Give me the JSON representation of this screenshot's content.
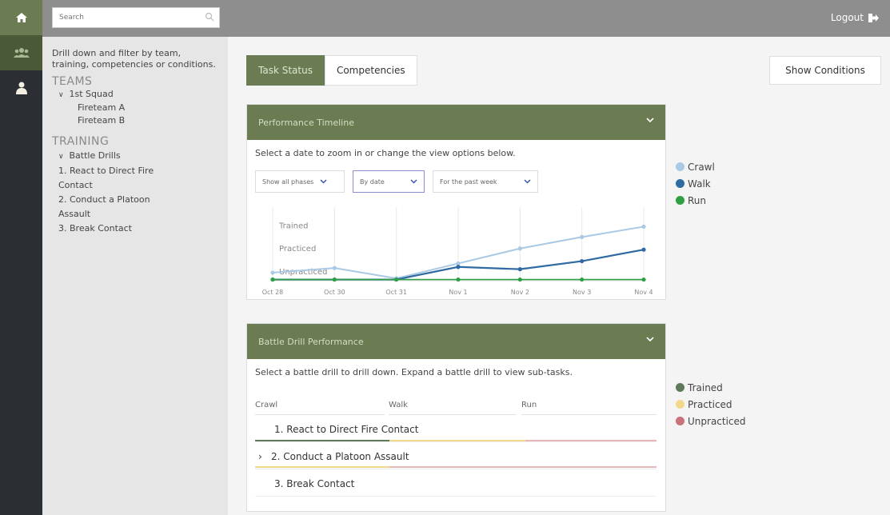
{
  "topbar": {
    "search_placeholder": "Search",
    "logout_label": "Logout"
  },
  "rail": {
    "icons": [
      "home-icon",
      "team-icon",
      "user-icon"
    ]
  },
  "filter": {
    "description": "Drill down and filter by team, training, competencies or conditions.",
    "teams_heading": "TEAMS",
    "squad": "1st Squad",
    "fireteam_a": "Fireteam A",
    "fireteam_b": "Fireteam B",
    "training_heading": "TRAINING",
    "battle_drills": "Battle Drills",
    "drill_1_line1": "1. React to Direct Fire",
    "drill_1_line2": "Contact",
    "drill_2_line1": "2. Conduct a Platoon",
    "drill_2_line2": "Assault",
    "drill_3": "3. Break Contact"
  },
  "tabs": {
    "task_status": "Task Status",
    "competencies": "Competencies",
    "show_conditions": "Show Conditions"
  },
  "performance": {
    "title": "Performance Timeline",
    "subtitle": "Select a date to zoom in or change the view options below.",
    "phase_select": "Show all phases",
    "by_select": "By date",
    "range_select": "For the past week"
  },
  "chart_data": {
    "type": "line",
    "x": [
      "Oct 28",
      "Oct 30",
      "Oct 31",
      "Nov 1",
      "Nov 2",
      "Nov 3",
      "Nov 4"
    ],
    "y_levels": [
      "Unpracticed",
      "Practiced",
      "Trained"
    ],
    "ylim": [
      0,
      3.2
    ],
    "series": [
      {
        "name": "Crawl",
        "color": "#a9c9e4",
        "values": [
          0.35,
          0.55,
          0.1,
          0.75,
          1.4,
          1.9,
          2.35
        ]
      },
      {
        "name": "Walk",
        "color": "#2f6aa3",
        "values": [
          0.05,
          0.05,
          0.05,
          0.6,
          0.5,
          0.85,
          1.35
        ]
      },
      {
        "name": "Run",
        "color": "#2ea043",
        "values": [
          0.05,
          0.05,
          0.05,
          0.05,
          0.05,
          0.05,
          0.05
        ]
      }
    ],
    "grid": true,
    "legend": "right"
  },
  "legend_status": [
    {
      "name": "Trained",
      "color": "#5e7a5a"
    },
    {
      "name": "Practiced",
      "color": "#f2d889"
    },
    {
      "name": "Unpracticed",
      "color": "#c9727a"
    }
  ],
  "drill": {
    "title": "Battle Drill Performance",
    "subtitle": "Select a battle drill to drill down. Expand a battle drill to view sub-tasks.",
    "col_crawl": "Crawl",
    "col_walk": "Walk",
    "col_run": "Run",
    "rows": [
      {
        "label": "1. React to Direct Fire Contact"
      },
      {
        "label": "2. Conduct a Platoon Assault"
      },
      {
        "label": "3. Break Contact"
      }
    ]
  }
}
